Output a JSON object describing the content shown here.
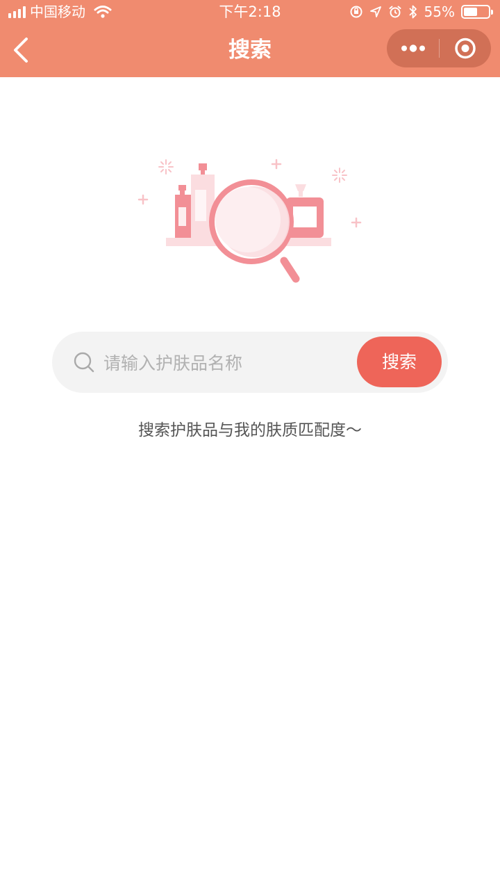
{
  "status_bar": {
    "carrier": "中国移动",
    "time": "下午2:18",
    "battery_percent": "55%",
    "battery_level": 0.55
  },
  "nav": {
    "title": "搜索",
    "back_icon": "chevron-left-icon",
    "more_icon": "more-dots-icon",
    "close_icon": "target-circle-icon"
  },
  "search": {
    "placeholder": "请输入护肤品名称",
    "value": "",
    "button_label": "搜索"
  },
  "hint": "搜索护肤品与我的肤质匹配度～",
  "colors": {
    "header": "#f08b6f",
    "accent": "#ee6559",
    "illustration_pink": "#f28f96",
    "illustration_light": "#fbdde0"
  }
}
